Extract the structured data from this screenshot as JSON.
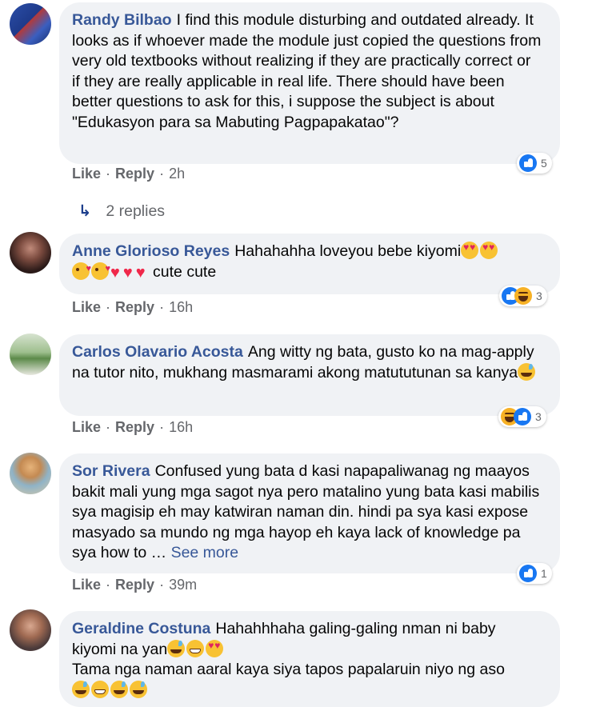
{
  "comments": [
    {
      "author": "Randy Bilbao",
      "text": "I find this module disturbing and outdated already. It looks as if whoever made the module just copied the questions from very old textbooks without realizing if they are practically correct or if they are really applicable in real life. There should have been better questions to ask for this, i suppose the subject is about \"Edukasyon para sa Mabuting Pagpapakatao\"?",
      "like_label": "Like",
      "reply_label": "Reply",
      "time": "2h",
      "reactions": [
        "like"
      ],
      "reaction_count": "5",
      "replies_label": "2 replies"
    },
    {
      "author": "Anne Glorioso Reyes",
      "text_a": "Hahahahha loveyou bebe kiyomi",
      "text_b": "cute cute",
      "like_label": "Like",
      "reply_label": "Reply",
      "time": "16h",
      "reactions": [
        "like",
        "haha"
      ],
      "reaction_count": "3"
    },
    {
      "author": "Carlos Olavario Acosta",
      "text": "Ang witty ng bata, gusto ko na mag-apply na tutor nito, mukhang masmarami akong matututunan sa kanya",
      "like_label": "Like",
      "reply_label": "Reply",
      "time": "16h",
      "reactions": [
        "haha",
        "like"
      ],
      "reaction_count": "3"
    },
    {
      "author": "Sor Rivera",
      "text": "Confused yung bata d kasi napapaliwanag ng maayos bakit mali yung mga sagot nya pero matalino yung bata kasi mabilis sya magisip eh may katwiran naman din. hindi pa sya kasi expose masyado sa mundo ng mga hayop eh kaya lack of knowledge pa sya how to …",
      "see_more": "See more",
      "like_label": "Like",
      "reply_label": "Reply",
      "time": "39m",
      "reactions": [
        "like"
      ],
      "reaction_count": "1"
    },
    {
      "author": "Geraldine Costuna",
      "text_a": "Hahahhhaha galing-galing nman ni baby kiyomi na yan",
      "text_b": "Tama nga naman aaral kaya siya tapos papalaruin niyo ng aso"
    }
  ],
  "colors": {
    "author": "#385898",
    "bubble": "#f0f2f5",
    "meta": "#65676b",
    "like_blue": "#1877f2",
    "haha_yellow": "#f7b125"
  }
}
